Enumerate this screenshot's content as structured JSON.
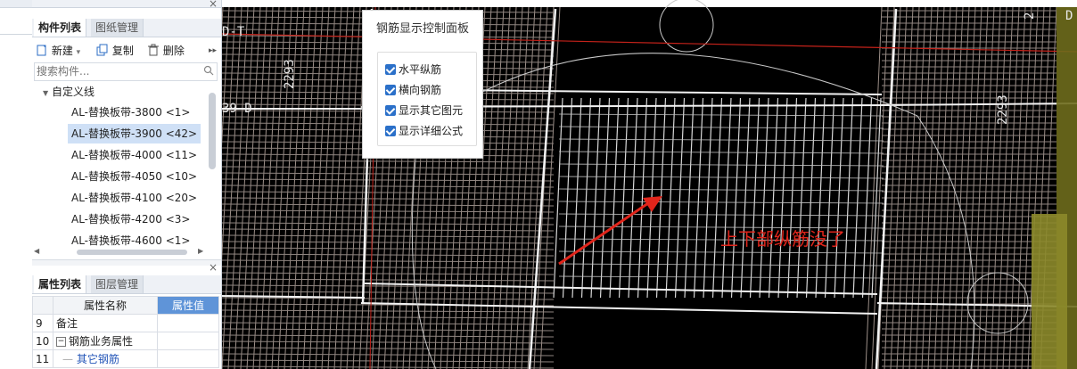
{
  "component_panel": {
    "tabs": [
      "构件列表",
      "图纸管理"
    ],
    "toolbar": {
      "new": "新建",
      "copy": "复制",
      "delete": "删除"
    },
    "search_placeholder": "搜索构件...",
    "tree_root": "自定义线",
    "items": [
      "AL-替换板带-3800 <1>",
      "AL-替换板带-3900 <42>",
      "AL-替换板带-4000 <11>",
      "AL-替换板带-4050 <10>",
      "AL-替换板带-4100 <20>",
      "AL-替换板带-4200 <3>",
      "AL-替换板带-4600 <1>"
    ],
    "selected_index": 1
  },
  "property_panel": {
    "tabs": [
      "属性列表",
      "图层管理"
    ],
    "headers": {
      "name": "属性名称",
      "value": "属性值"
    },
    "rows": [
      {
        "num": "9",
        "name": "备注"
      },
      {
        "num": "10",
        "name": "钢筋业务属性"
      },
      {
        "num": "11",
        "name": "其它钢筋"
      }
    ]
  },
  "control_panel": {
    "title": "钢筋显示控制面板",
    "options": [
      "水平纵筋",
      "横向钢筋",
      "显示其它图元",
      "显示详细公式"
    ]
  },
  "cad": {
    "labels": {
      "axis_a": "D-T",
      "axis_b": "39-D",
      "dim_left": "2293",
      "dim_right": "2293",
      "right_edge": "D",
      "top_right": "2"
    },
    "annotation": "上下部纵筋没了",
    "annotation_color": "#e1251b"
  }
}
